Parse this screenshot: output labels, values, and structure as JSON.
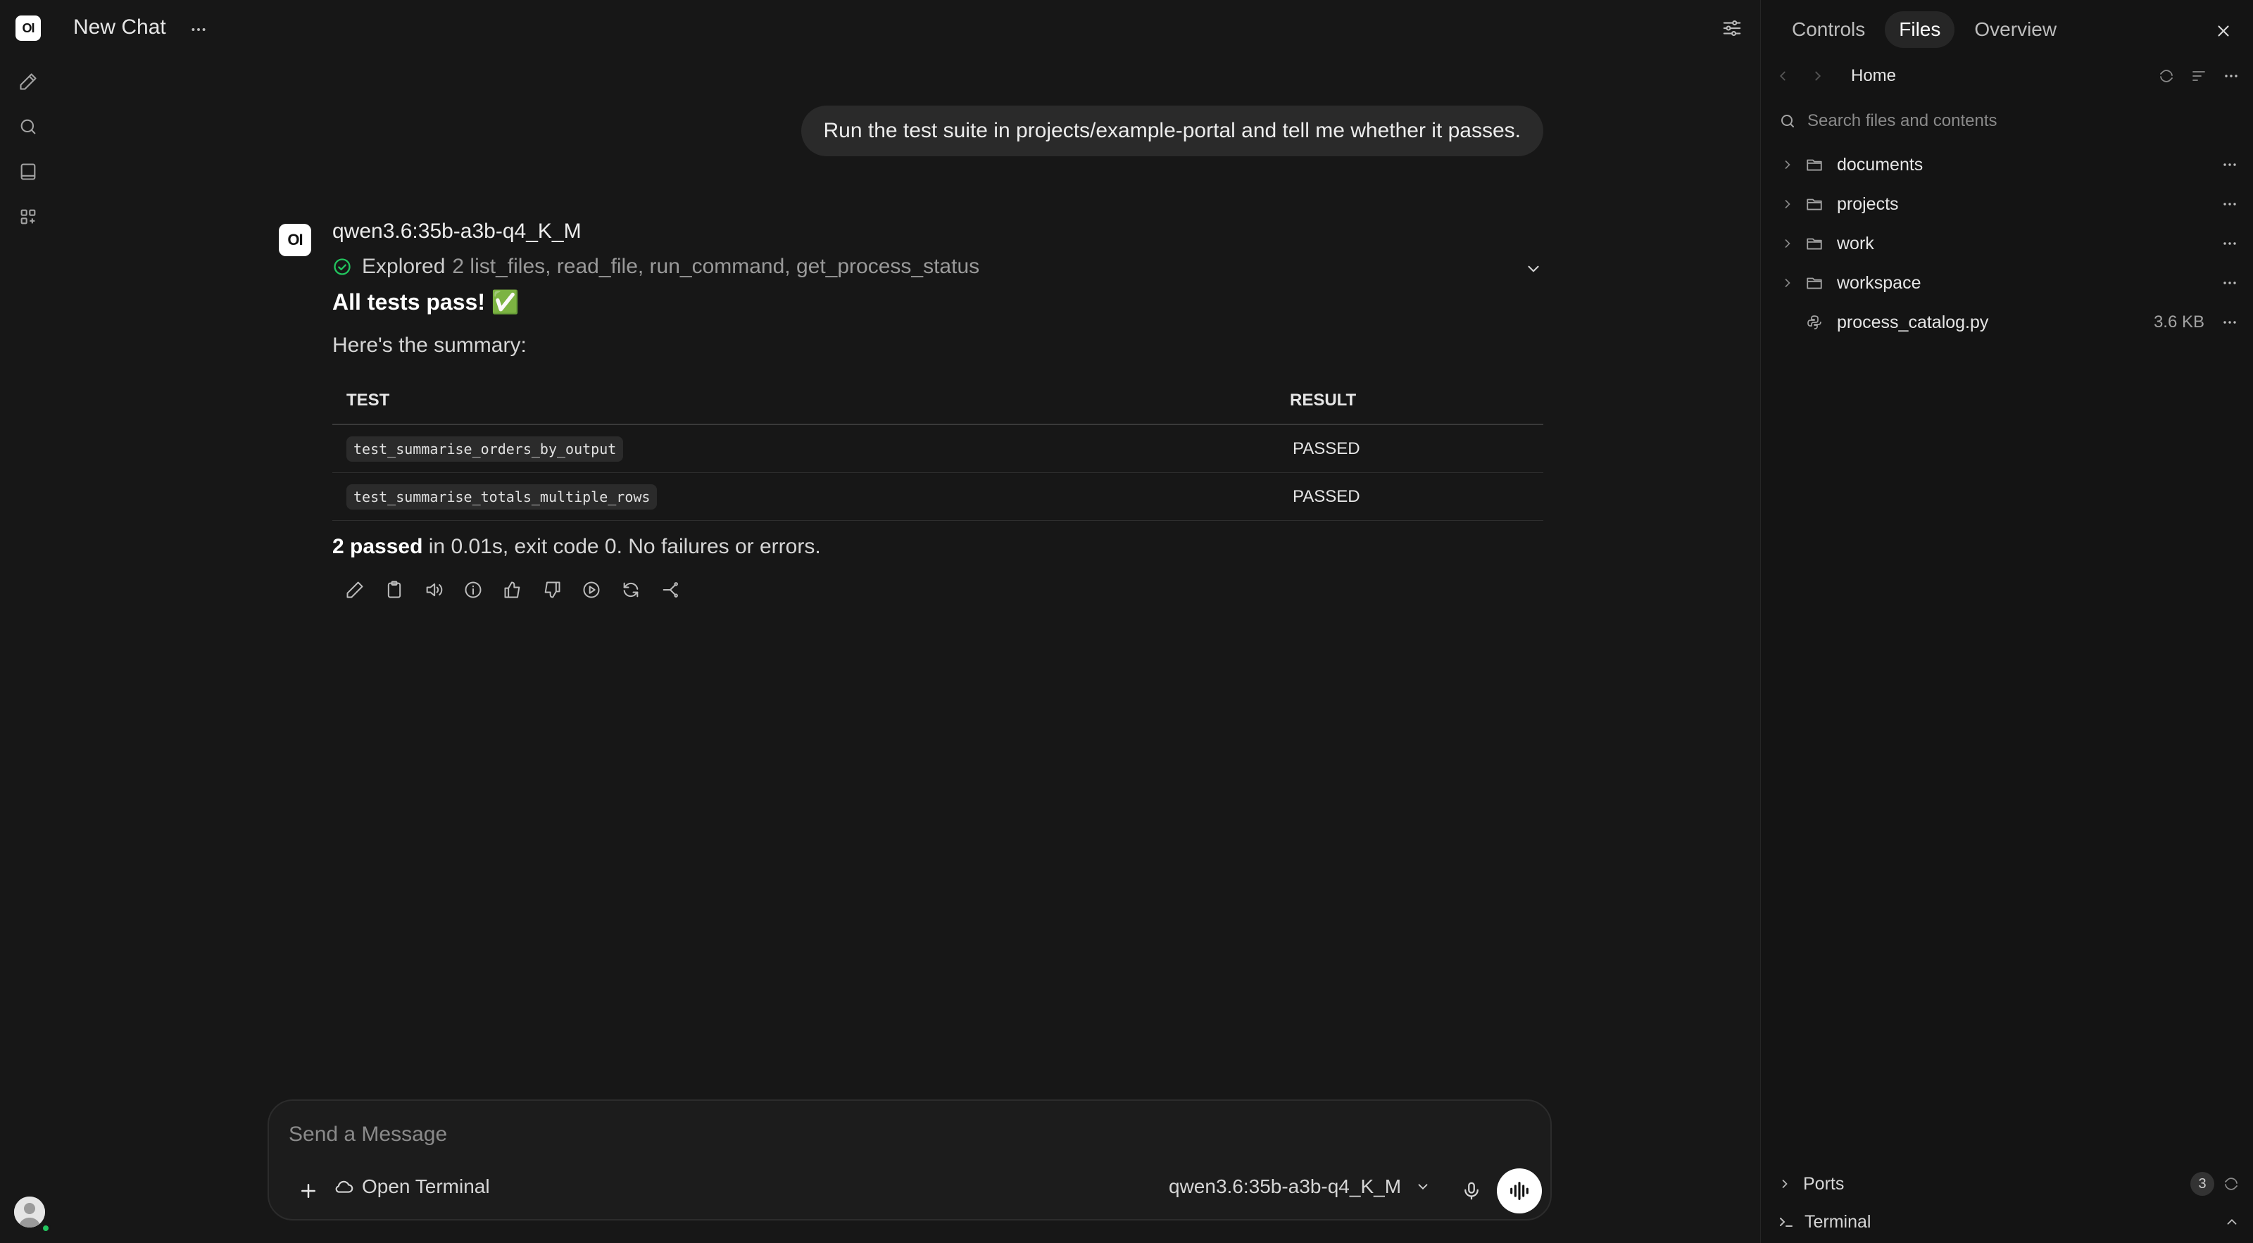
{
  "app": {
    "logo_text": "OI"
  },
  "header": {
    "title": "New Chat"
  },
  "conversation": {
    "user_message": "Run the test suite in projects/example-portal and tell me whether it passes.",
    "assistant": {
      "avatar_text": "OI",
      "model": "qwen3.6:35b-a3b-q4_K_M",
      "explored_label": "Explored",
      "explored_detail": "2 list_files, read_file, run_command, get_process_status",
      "headline": "All tests pass! ✅",
      "summary_intro": "Here's the summary:",
      "table": {
        "headers": [
          "TEST",
          "RESULT"
        ],
        "rows": [
          {
            "test": "test_summarise_orders_by_output",
            "result": "PASSED"
          },
          {
            "test": "test_summarise_totals_multiple_rows",
            "result": "PASSED"
          }
        ]
      },
      "footer_bold": "2 passed",
      "footer_rest": " in 0.01s, exit code 0. No failures or errors."
    }
  },
  "composer": {
    "placeholder": "Send a Message",
    "terminal_label": "Open Terminal",
    "model": "qwen3.6:35b-a3b-q4_K_M"
  },
  "panel": {
    "tabs": [
      "Controls",
      "Files",
      "Overview"
    ],
    "active_tab": "Files",
    "breadcrumb": "Home",
    "search_placeholder": "Search files and contents",
    "files": [
      {
        "name": "documents",
        "type": "folder",
        "size": ""
      },
      {
        "name": "projects",
        "type": "folder",
        "size": ""
      },
      {
        "name": "work",
        "type": "folder",
        "size": ""
      },
      {
        "name": "workspace",
        "type": "folder",
        "size": ""
      },
      {
        "name": "process_catalog.py",
        "type": "file",
        "size": "3.6 KB"
      }
    ],
    "ports_label": "Ports",
    "ports_count": "3",
    "terminal_label": "Terminal"
  },
  "colors": {
    "background": "#171717",
    "panel": "#141414",
    "accent_success": "#22c55e"
  }
}
